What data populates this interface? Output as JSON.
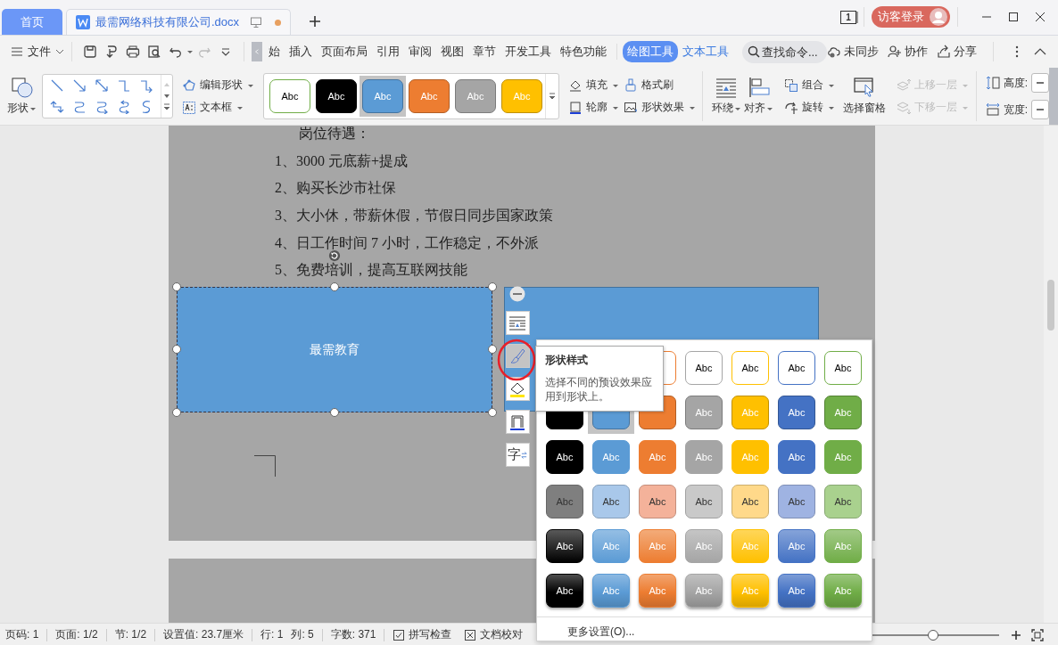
{
  "tabs": [
    {
      "kind": "home",
      "label": "首页",
      "selected": false
    },
    {
      "kind": "document",
      "label": "最需网络科技有限公司.docx",
      "selected": true,
      "modified": true
    }
  ],
  "window_count": "1",
  "login": "访客登录",
  "file_menu": "文件",
  "ribbon_tabs": [
    {
      "label": "始",
      "selected": false,
      "contextual": false
    },
    {
      "label": "插入",
      "selected": false,
      "contextual": false
    },
    {
      "label": "页面布局",
      "selected": false,
      "contextual": false
    },
    {
      "label": "引用",
      "selected": false,
      "contextual": false
    },
    {
      "label": "审阅",
      "selected": false,
      "contextual": false
    },
    {
      "label": "视图",
      "selected": false,
      "contextual": false
    },
    {
      "label": "章节",
      "selected": false,
      "contextual": false
    },
    {
      "label": "开发工具",
      "selected": false,
      "contextual": false
    },
    {
      "label": "特色功能",
      "selected": false,
      "contextual": false
    },
    {
      "label": "绘图工具",
      "selected": true,
      "contextual": true
    },
    {
      "label": "文本工具",
      "selected": false,
      "contextual": true
    }
  ],
  "search": {
    "placeholder": "查找命令..."
  },
  "actions": [
    {
      "label": "未同步"
    },
    {
      "label": "协作"
    },
    {
      "label": "分享"
    }
  ],
  "ribbon": {
    "shape_button": "形状",
    "edit_shape": "编辑形状",
    "text_box": "文本框",
    "style_gallery": [
      {
        "label": "Abc",
        "kind": "outline",
        "color": "#70ad47",
        "selected": false
      },
      {
        "label": "Abc",
        "kind": "solid",
        "color": "#000000",
        "selected": false
      },
      {
        "label": "Abc",
        "kind": "solid",
        "color": "#5b9bd5",
        "selected": true
      },
      {
        "label": "Abc",
        "kind": "solid",
        "color": "#ed7d31",
        "selected": false
      },
      {
        "label": "Abc",
        "kind": "solid",
        "color": "#a5a5a5",
        "selected": false
      },
      {
        "label": "Abc",
        "kind": "solid",
        "color": "#ffc000",
        "selected": false
      }
    ],
    "fill": "填充",
    "format_painter": "格式刷",
    "outline": "轮廓",
    "shape_effects": "形状效果",
    "wrap": "环绕",
    "align": "对齐",
    "group": "组合",
    "rotate": "旋转",
    "selection_pane": "选择窗格",
    "bring_forward": {
      "label": "上移一层",
      "disabled": true
    },
    "send_backward": {
      "label": "下移一层",
      "disabled": true
    },
    "height_label": "高度:",
    "width_label": "宽度:"
  },
  "document": {
    "lines": [
      "岗位待遇：",
      "1、3000 元底薪+提成",
      "2、购买长沙市社保",
      "3、大小休，带薪休假，节假日同步国家政策",
      "4、日工作时间 7 小时，工作稳定，不外派",
      "5、免费培训，提高互联网技能"
    ],
    "selected_shape": {
      "text": "最需教育"
    }
  },
  "shape_toolbar": [
    {
      "kind": "wrap",
      "selected": false
    },
    {
      "kind": "style",
      "selected": true
    },
    {
      "kind": "fill",
      "selected": false
    },
    {
      "kind": "outline",
      "selected": false
    },
    {
      "kind": "text",
      "label": "字",
      "selected": false
    }
  ],
  "tooltip": {
    "title": "形状样式",
    "text": "选择不同的预设效果应用到形状上。"
  },
  "style_panel": {
    "rows": [
      {
        "kind": "outline",
        "cells": [
          null,
          null,
          {
            "color": "#ed7d31",
            "selected": false
          },
          {
            "label": "Abc",
            "color": "#a5a5a5",
            "selected": false
          },
          {
            "label": "Abc",
            "color": "#ffc000",
            "selected": false
          },
          {
            "label": "Abc",
            "color": "#4472c4",
            "selected": false
          },
          {
            "label": "Abc",
            "color": "#70ad47",
            "selected": false
          }
        ]
      },
      {
        "kind": "solid",
        "cells": [
          {
            "color": "#000000",
            "selected": false
          },
          {
            "color": "#5b9bd5",
            "selected": true
          },
          {
            "color": "#ed7d31",
            "selected": false
          },
          {
            "label": "Abc",
            "color": "#a5a5a5",
            "selected": false
          },
          {
            "label": "Abc",
            "color": "#ffc000",
            "selected": false
          },
          {
            "label": "Abc",
            "color": "#4472c4",
            "selected": false
          },
          {
            "label": "Abc",
            "color": "#70ad47",
            "selected": false
          }
        ]
      },
      {
        "kind": "flat",
        "cells": [
          {
            "label": "Abc",
            "color": "#000000",
            "selected": false
          },
          {
            "label": "Abc",
            "color": "#5b9bd5",
            "selected": false
          },
          {
            "label": "Abc",
            "color": "#ed7d31",
            "selected": false
          },
          {
            "label": "Abc",
            "color": "#a5a5a5",
            "selected": false
          },
          {
            "label": "Abc",
            "color": "#ffc000",
            "selected": false
          },
          {
            "label": "Abc",
            "color": "#4472c4",
            "selected": false
          },
          {
            "label": "Abc",
            "color": "#70ad47",
            "selected": false
          }
        ]
      },
      {
        "kind": "light",
        "cells": [
          {
            "label": "Abc",
            "color": "#7f7f7f",
            "selected": false
          },
          {
            "label": "Abc",
            "color": "#a9c8ea",
            "selected": false
          },
          {
            "label": "Abc",
            "color": "#f4b29a",
            "selected": false
          },
          {
            "label": "Abc",
            "color": "#c9c9c9",
            "selected": false
          },
          {
            "label": "Abc",
            "color": "#ffd98a",
            "selected": false
          },
          {
            "label": "Abc",
            "color": "#9fb3e2",
            "selected": false
          },
          {
            "label": "Abc",
            "color": "#a9d18e",
            "selected": false
          }
        ]
      },
      {
        "kind": "gradient",
        "cells": [
          {
            "label": "Abc",
            "color": "#000000",
            "selected": false
          },
          {
            "label": "Abc",
            "color": "#5b9bd5",
            "selected": false
          },
          {
            "label": "Abc",
            "color": "#ed7d31",
            "selected": false
          },
          {
            "label": "Abc",
            "color": "#a5a5a5",
            "selected": false
          },
          {
            "label": "Abc",
            "color": "#ffc000",
            "selected": false
          },
          {
            "label": "Abc",
            "color": "#4472c4",
            "selected": false
          },
          {
            "label": "Abc",
            "color": "#70ad47",
            "selected": false
          }
        ]
      },
      {
        "kind": "glossy",
        "cells": [
          {
            "label": "Abc",
            "color": "#000000",
            "selected": false
          },
          {
            "label": "Abc",
            "color": "#5b9bd5",
            "selected": false
          },
          {
            "label": "Abc",
            "color": "#ed7d31",
            "selected": false
          },
          {
            "label": "Abc",
            "color": "#a5a5a5",
            "selected": false
          },
          {
            "label": "Abc",
            "color": "#ffc000",
            "selected": false
          },
          {
            "label": "Abc",
            "color": "#4472c4",
            "selected": false
          },
          {
            "label": "Abc",
            "color": "#70ad47",
            "selected": false
          }
        ]
      }
    ],
    "more": "更多设置(O)..."
  },
  "status_bar": {
    "items": [
      "页码: 1",
      "页面: 1/2",
      "节: 1/2",
      "设置值: 23.7厘米",
      "行: 1",
      "列: 5",
      "字数: 371"
    ],
    "buttons": [
      {
        "label": "拼写检查"
      },
      {
        "label": "文档校对"
      }
    ],
    "zoom": {
      "level": 0.48
    }
  }
}
